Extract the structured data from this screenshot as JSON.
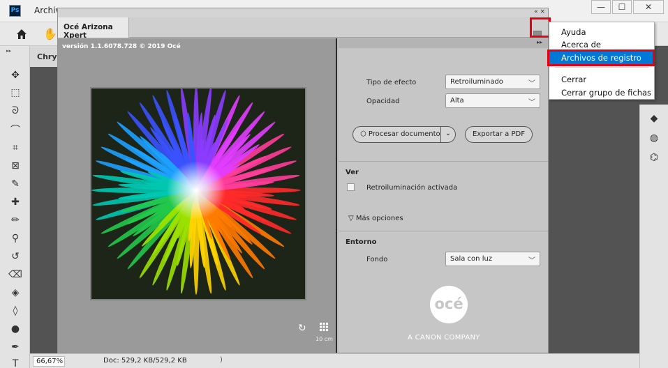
{
  "photoshop": {
    "menu_first": "Archiv",
    "logo": "Ps",
    "doc_tab": "Chrys",
    "zoom": "66,67%",
    "doc_size": "Doc: 529,2 KB/529,2 KB",
    "status_arrow": ")",
    "window_controls": [
      "—",
      "☐",
      "✕"
    ]
  },
  "plugin": {
    "tab_title": "Océ Arizona Xpert",
    "version": "versión 1.1.6078.728 © 2019 Océ",
    "strip_icons": "«  ×",
    "scale_label": "10 cm",
    "settings": {
      "effect_label": "Tipo de efecto",
      "effect_value": "Retroiluminado",
      "opacity_label": "Opacidad",
      "opacity_value": "Alta",
      "process_button": "Procesar documento",
      "export_button": "Exportar a PDF",
      "view_section": "Ver",
      "backlight_checkbox": "Retroiluminación activada",
      "more_options": "Más opciones",
      "environment_section": "Entorno",
      "background_label": "Fondo",
      "background_value": "Sala con luz"
    },
    "brand": {
      "logo_text": "océ",
      "tagline": "A CANON COMPANY"
    }
  },
  "context_menu": {
    "items": [
      "Ayuda",
      "Acerca de",
      "Archivos de registro",
      "Cerrar",
      "Cerrar grupo de fichas"
    ],
    "selected_index": 2
  },
  "colors": {
    "highlight": "#e8000e",
    "menu_selected": "#0078d7"
  }
}
